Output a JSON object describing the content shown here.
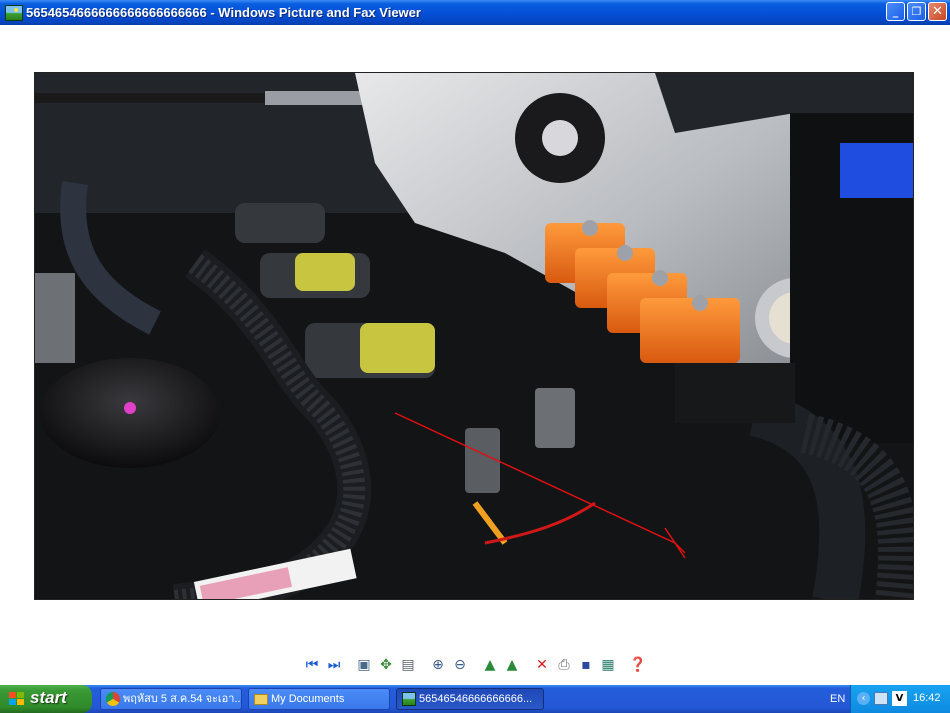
{
  "window": {
    "title": "5654654666666666666666666 - Windows Picture and Fax Viewer"
  },
  "image": {
    "subject": "engine bay photo with orange gas injectors and ignition coils"
  },
  "toolbar": {
    "buttons": [
      "previous-image-icon",
      "next-image-icon",
      "best-fit-icon",
      "actual-size-icon",
      "slideshow-icon",
      "zoom-in-icon",
      "zoom-out-icon",
      "rotate-clockwise-icon",
      "rotate-counterclockwise-icon",
      "delete-icon",
      "print-icon",
      "save-icon",
      "edit-icon",
      "help-icon"
    ]
  },
  "taskbar": {
    "start_label": "start",
    "tasks": [
      {
        "label": "พฤหัสบ 5 ส.ค.54 จะเอา...",
        "icon": "chrome-icon"
      },
      {
        "label": "My Documents",
        "icon": "folder-icon"
      },
      {
        "label": "56546546666666666...",
        "icon": "picture-viewer-icon",
        "active": true
      }
    ],
    "language": "EN",
    "clock": "16:42"
  },
  "colors": {
    "titlebar": "#0550d8",
    "taskbar": "#245edb",
    "start": "#3a9a35",
    "tray": "#0d8ae0",
    "injector": "#f07a20"
  }
}
